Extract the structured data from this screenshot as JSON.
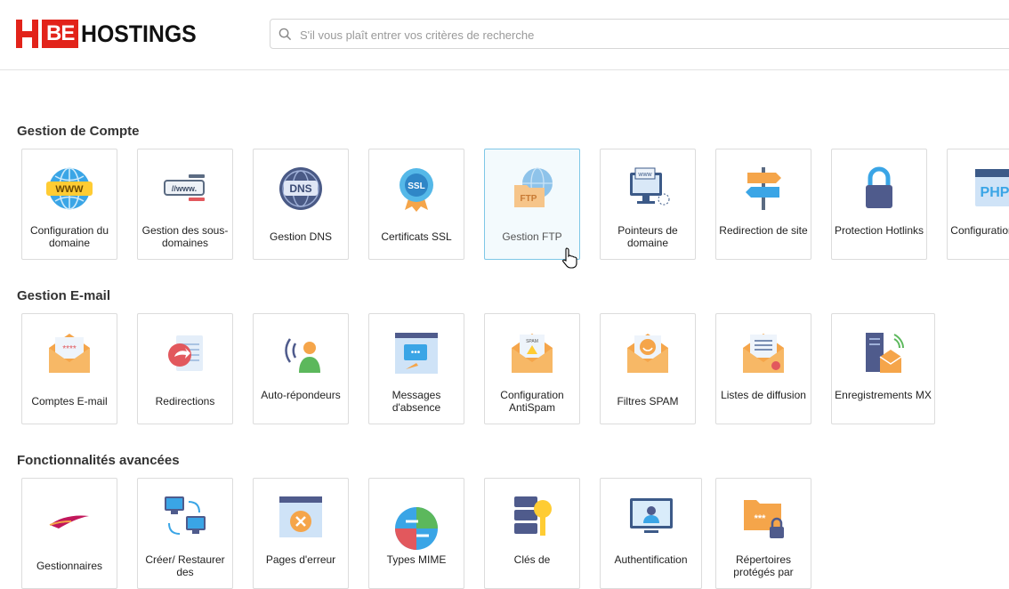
{
  "brand": {
    "be": "BE",
    "name": "HOSTINGS"
  },
  "search": {
    "placeholder": "S'il vous plaît entrer vos critères de recherche"
  },
  "sections": {
    "account": {
      "title": "Gestion de Compte",
      "items": [
        "Configuration du domaine",
        "Gestion des sous-domaines",
        "Gestion DNS",
        "Certificats SSL",
        "Gestion FTP",
        "Pointeurs de domaine",
        "Redirection de site",
        "Protection Hotlinks",
        "Configuration PHP"
      ]
    },
    "email": {
      "title": "Gestion E-mail",
      "items": [
        "Comptes E-mail",
        "Redirections",
        "Auto-répondeurs",
        "Messages d'absence",
        "Configuration AntiSpam",
        "Filtres SPAM",
        "Listes de diffusion",
        "Enregistrements MX"
      ]
    },
    "advanced": {
      "title": "Fonctionnalités avancées",
      "items": [
        "Gestionnaires",
        "Créer/ Restaurer des",
        "Pages d'erreur",
        "Types MIME",
        "Clés de",
        "Authentification",
        "Répertoires protégés par"
      ]
    }
  },
  "icon_texts": {
    "www": "WWW",
    "dns": "DNS",
    "ssl": "SSL",
    "ftp": "FTP",
    "php": "PHP",
    "www_small": "www",
    "spam": "SPAM"
  },
  "colors": {
    "brand_red": "#e2231a",
    "active_border": "#7ec7e6",
    "orange": "#f5a54a",
    "blue": "#3d8fd6"
  }
}
